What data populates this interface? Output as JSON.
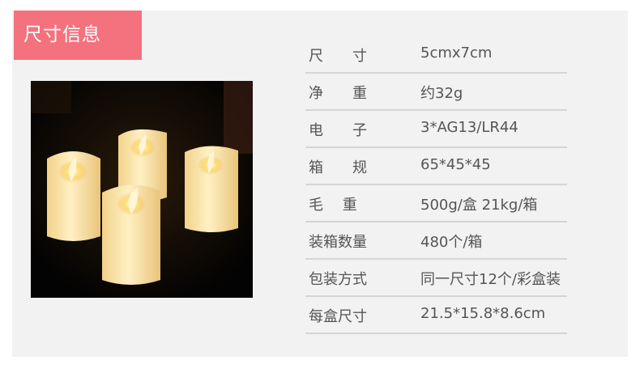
{
  "section": {
    "title": "尺寸信息"
  },
  "product_image": {
    "subject": "four-led-pillar-candles"
  },
  "specs": [
    {
      "label": "尺　　寸",
      "value": "5cmx7cm"
    },
    {
      "label": "净　　重",
      "value": "约32g"
    },
    {
      "label": "电　　子",
      "value": "3*AG13/LR44"
    },
    {
      "label": "箱　　规",
      "value": "65*45*45"
    },
    {
      "label": "毛　 重",
      "value": "500g/盒 21kg/箱"
    },
    {
      "label": "装箱数量",
      "value": "480个/箱"
    },
    {
      "label": "包装方式",
      "value": "同一尺寸12个/彩盒装"
    },
    {
      "label": "每盒尺寸",
      "value": "21.5*15.8*8.6cm"
    }
  ],
  "colors": {
    "accent": "#f3727e",
    "panel": "#f2f2f2",
    "text": "#555555",
    "divider": "#d5d5d5"
  }
}
